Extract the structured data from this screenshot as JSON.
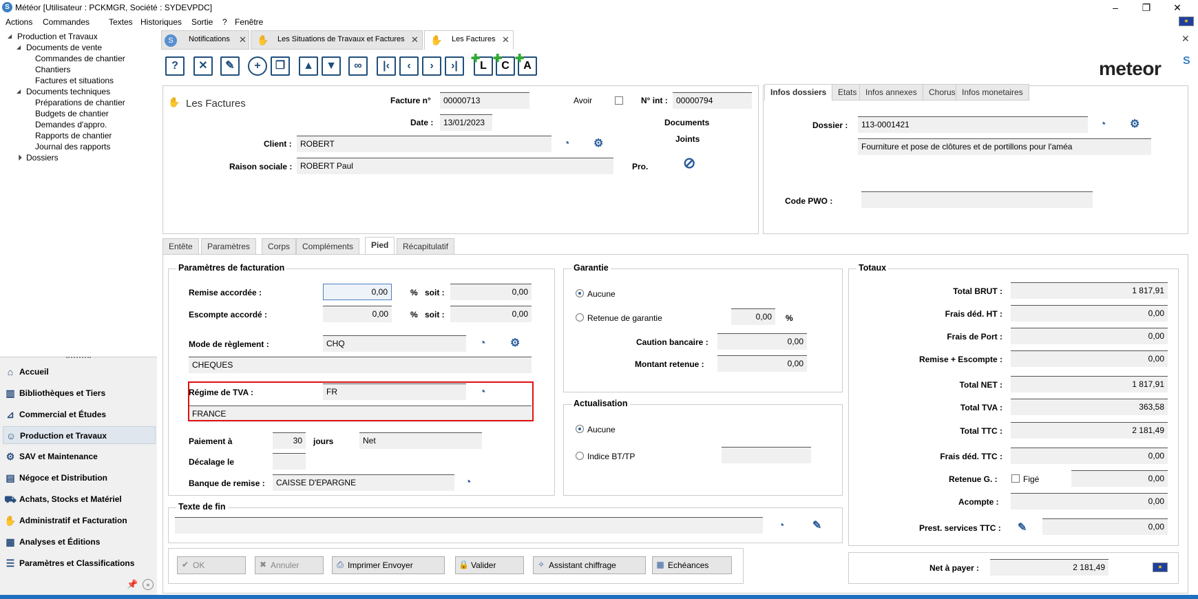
{
  "window": {
    "title": "Météor [Utilisateur : PCKMGR, Société : SYDEVPDC]"
  },
  "menu": [
    "Actions",
    "Commandes",
    "Textes",
    "Historiques",
    "Sortie",
    "?",
    "Fenêtre"
  ],
  "tree": {
    "root": "Production et Travaux",
    "docs_vente": "Documents de vente",
    "cmd": "Commandes de chantier",
    "chantiers": "Chantiers",
    "factures": "Factures et situations",
    "docs_tech": "Documents techniques",
    "prep": "Préparations de chantier",
    "budgets": "Budgets de chantier",
    "demandes": "Demandes d'appro.",
    "rapports": "Rapports de chantier",
    "journal": "Journal des rapports",
    "dossiers": "Dossiers"
  },
  "nav": [
    "Accueil",
    "Bibliothèques et Tiers",
    "Commercial et Études",
    "Production et Travaux",
    "SAV et Maintenance",
    "Négoce et Distribution",
    "Achats, Stocks et Matériel",
    "Administratif et Facturation",
    "Analyses et Éditions",
    "Paramètres et Classifications"
  ],
  "tabs": [
    "Notifications",
    "Les Situations de Travaux et Factures",
    "Les Factures"
  ],
  "logo": "meteor",
  "header": {
    "title": "Les Factures",
    "facture_label": "Facture n°",
    "facture": "00000713",
    "avoir_label": "Avoir",
    "nint_label": "N° int :",
    "nint": "00000794",
    "date_label": "Date :",
    "date": "13/01/2023",
    "client_label": "Client :",
    "client": "ROBERT",
    "raison_label": "Raison sociale :",
    "raison": "ROBERT Paul",
    "docs_label": "Documents",
    "joints_label": "Joints",
    "pro_label": "Pro."
  },
  "infos": {
    "tabs": [
      "Infos dossiers",
      "Etats",
      "Infos annexes",
      "Chorus",
      "Infos monetaires"
    ],
    "dossier_label": "Dossier :",
    "dossier": "113-0001421",
    "dossier_desc": "Fourniture et pose de clôtures et de portillons pour l'améa",
    "codepwo_label": "Code PWO :"
  },
  "subtabs": [
    "Entête",
    "Paramètres",
    "Corps",
    "Compléments",
    "Pied",
    "Récapitulatif"
  ],
  "param": {
    "title": "Paramètres de facturation",
    "remise_label": "Remise accordée :",
    "remise": "0,00",
    "pct": "%",
    "soit": "soit :",
    "remise_soit": "0,00",
    "escompte_label": "Escompte accordé :",
    "escompte": "0,00",
    "escompte_soit": "0,00",
    "mode_label": "Mode de règlement :",
    "mode": "CHQ",
    "mode_desc": "CHEQUES",
    "tva_label": "Régime de TVA :",
    "tva": "FR",
    "tva_desc": "FRANCE",
    "paiement_label": "Paiement à",
    "paiement": "30",
    "jours": "jours",
    "net": "Net",
    "decalage_label": "Décalage le",
    "banque_label": "Banque de remise :",
    "banque": "CAISSE D'EPARGNE"
  },
  "garantie": {
    "title": "Garantie",
    "aucune": "Aucune",
    "retenue": "Retenue de garantie",
    "retenue_val": "0,00",
    "pct": "%",
    "caution_label": "Caution bancaire :",
    "caution": "0,00",
    "montant_label": "Montant retenue :",
    "montant": "0,00"
  },
  "actualisation": {
    "title": "Actualisation",
    "aucune": "Aucune",
    "indice": "Indice BT/TP"
  },
  "texte": {
    "title": "Texte de fin"
  },
  "totaux": {
    "title": "Totaux",
    "rows": [
      {
        "label": "Total BRUT :",
        "value": "1 817,91"
      },
      {
        "label": "Frais déd. HT :",
        "value": "0,00"
      },
      {
        "label": "Frais de Port :",
        "value": "0,00"
      },
      {
        "label": "Remise + Escompte :",
        "value": "0,00"
      },
      {
        "label": "Total NET :",
        "value": "1 817,91"
      },
      {
        "label": "Total TVA :",
        "value": "363,58"
      },
      {
        "label": "Total TTC :",
        "value": "2 181,49"
      },
      {
        "label": "Frais déd. TTC :",
        "value": "0,00"
      }
    ],
    "retenue_label": "Retenue G. :",
    "fige": "Figé",
    "retenue": "0,00",
    "acompte_label": "Acompte :",
    "acompte": "0,00",
    "prest_label": "Prest. services TTC :",
    "prest": "0,00",
    "net_label": "Net à payer :",
    "net": "2 181,49"
  },
  "buttons": {
    "ok": "OK",
    "annuler": "Annuler",
    "imprimer": "Imprimer Envoyer",
    "valider": "Valider",
    "assistant": "Assistant chiffrage",
    "echeances": "Echéances"
  }
}
